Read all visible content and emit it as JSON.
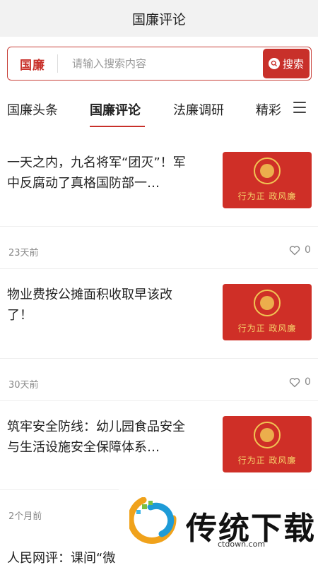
{
  "header": {
    "title": "国廉评论"
  },
  "search": {
    "logo_text": "国廉",
    "placeholder": "请输入搜索内容",
    "button_label": "搜索"
  },
  "tabs": [
    {
      "label": "国廉头条"
    },
    {
      "label": "国廉评论"
    },
    {
      "label": "法廉调研"
    },
    {
      "label": "精彩"
    }
  ],
  "articles": [
    {
      "title": "一天之内，九名将军“团灭”！军中反腐动了真格国防部一…",
      "thumb_text": "行为正 政风廉",
      "time": "23天前",
      "likes": "0"
    },
    {
      "title": "物业费按公摊面积收取早该改了！",
      "thumb_text": "行为正 政风廉",
      "time": "30天前",
      "likes": "0"
    },
    {
      "title": "筑牢安全防线：幼儿园食品安全与生活设施安全保障体系…",
      "thumb_text": "行为正 政风廉",
      "time": "2个月前",
      "likes": ""
    },
    {
      "title": "人民网评：课间“微",
      "thumb_text": "",
      "time": "",
      "likes": ""
    }
  ],
  "watermark": {
    "text": "传统下载",
    "url": "ctdown.com"
  },
  "colors": {
    "accent": "#c8302a",
    "thumb_bg": "#cf2f27",
    "thumb_text": "#f6d36b"
  }
}
